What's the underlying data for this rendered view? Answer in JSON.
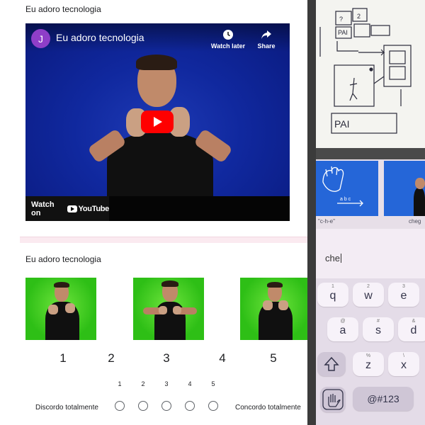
{
  "form": {
    "question1_title": "Eu adoro tecnologia",
    "question2_title": "Eu adoro tecnologia",
    "video": {
      "channel_initial": "J",
      "title": "Eu adoro tecnologia",
      "watch_later_label": "Watch later",
      "share_label": "Share",
      "watch_on_label": "Watch on",
      "youtube_label": "YouTube"
    },
    "scale_numbers": [
      "1",
      "2",
      "3",
      "4",
      "5"
    ],
    "radio_numbers": [
      "1",
      "2",
      "3",
      "4",
      "5"
    ],
    "low_label": "Discordo totalmente",
    "high_label": "Concordo totalmente"
  },
  "phone": {
    "caption_left": "\"c-h-e\"",
    "caption_right": "cheg",
    "card_text": "a b c",
    "typed_text": "che",
    "keys_row1": [
      {
        "hint": "1",
        "ch": "q"
      },
      {
        "hint": "2",
        "ch": "w"
      },
      {
        "hint": "3",
        "ch": "e"
      }
    ],
    "keys_row2": [
      {
        "hint": "@",
        "ch": "a"
      },
      {
        "hint": "#",
        "ch": "s"
      },
      {
        "hint": "&",
        "ch": "d"
      }
    ],
    "keys_row3": [
      {
        "hint": "%",
        "ch": "z"
      },
      {
        "hint": "\\",
        "ch": "x"
      }
    ],
    "symbols_key": "@#123"
  },
  "whiteboard": {
    "label_pai_small": "PAI",
    "label_pai_large": "PAI",
    "glyph_a": "?",
    "glyph_b": "2"
  },
  "colors": {
    "video_bg": "#10289e",
    "chroma_green": "#35c81e",
    "play_red": "#ff0000",
    "phone_card_blue": "#2566d8"
  }
}
